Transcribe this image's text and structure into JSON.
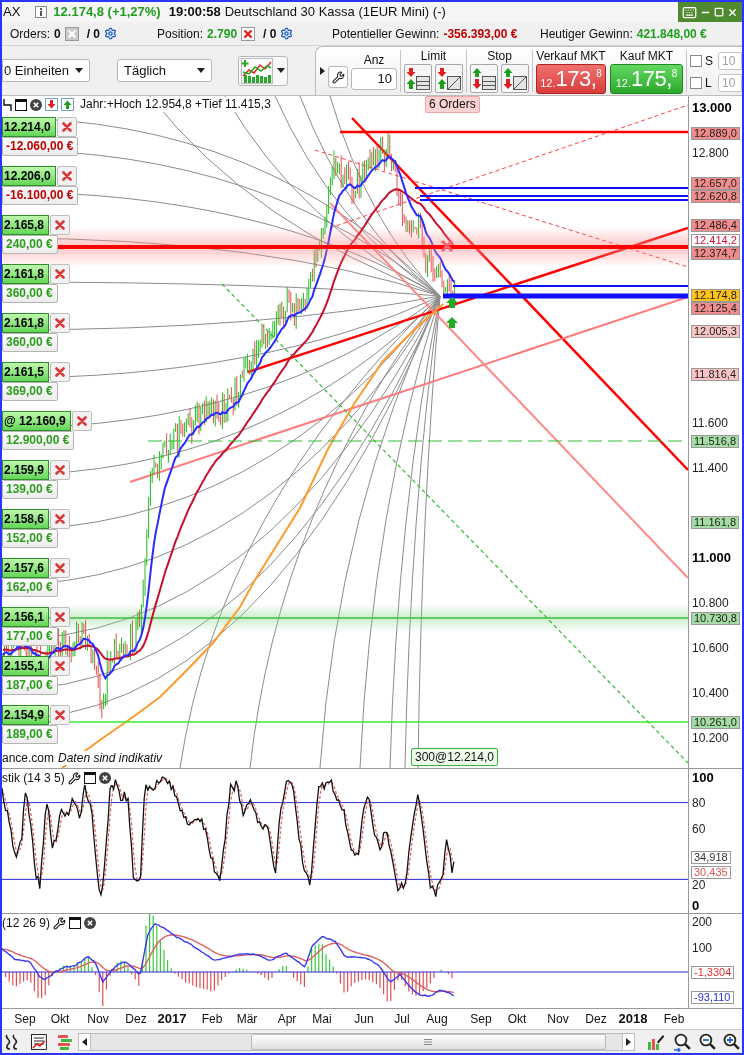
{
  "title_bar": {
    "symbol": "AX",
    "quote": "12.174,8 (+1,27%)",
    "time": "19:00:58",
    "instrument": "Deutschland 30 Kassa (1EUR Mini) (-)"
  },
  "account_bar": {
    "orders": {
      "label": "Orders:",
      "count": "0",
      "pending": "/ 0"
    },
    "position": {
      "label": "Position:",
      "value": "2.790",
      "pending": "/ 0"
    },
    "potential_profit": {
      "label": "Potentieller Gewinn:",
      "value": "-356.393,00 €"
    },
    "daily_profit": {
      "label": "Heutiger Gewinn:",
      "value": "421.848,00 €"
    }
  },
  "toolbar": {
    "units": "0 Einheiten",
    "interval": "Täglich"
  },
  "order_panel": {
    "quantity": {
      "label": "Anz",
      "value": "10"
    },
    "limit_label": "Limit",
    "stop_label": "Stop",
    "sell": {
      "label": "Verkauf MKT",
      "prefix": "12.",
      "main": "173,",
      "pip": "8"
    },
    "buy": {
      "label": "Kauf MKT",
      "prefix": "12.",
      "main": "175,",
      "pip": "8"
    },
    "sides": [
      {
        "label": "S",
        "checked": false,
        "value": "10",
        "disabled": true
      },
      {
        "label": "L",
        "checked": false,
        "value": "10",
        "disabled": true
      }
    ]
  },
  "chart": {
    "legend": "Jahr:+Hoch 12.954,8 +Tief 11.415,3",
    "orders_badge": "6 Orders",
    "orders": [
      {
        "price": "12.214,0",
        "profit": "-12.060,00 €",
        "loss": true
      },
      {
        "price": "12.206,0",
        "profit": "-16.100,00 €",
        "loss": true
      },
      {
        "price": "2.165,8",
        "profit": "240,00 €",
        "loss": false
      },
      {
        "price": "2.161,8",
        "profit": "360,00 €",
        "loss": false
      },
      {
        "price": "2.161,8",
        "profit": "360,00 €",
        "loss": false
      },
      {
        "price": "2.161,5",
        "profit": "369,00 €",
        "loss": false
      },
      {
        "price": "@ 12.160,9",
        "profit": "12.900,00 €",
        "loss": false
      },
      {
        "price": "2.159,9",
        "profit": "139,00 €",
        "loss": false
      },
      {
        "price": "2.158,6",
        "profit": "152,00 €",
        "loss": false
      },
      {
        "price": "2.157,6",
        "profit": "162,00 €",
        "loss": false
      },
      {
        "price": "2.156,1",
        "profit": "177,00 €",
        "loss": false
      },
      {
        "price": "2.155,1",
        "profit": "187,00 €",
        "loss": false
      },
      {
        "price": "2.154,9",
        "profit": "189,00 €",
        "loss": false
      }
    ],
    "source": "ance.com",
    "disclaimer": "Daten sind indikativ",
    "position_marker": "300@12.214,0",
    "axis_ticks": [
      {
        "label": "13.000",
        "major": true
      },
      {
        "label": "12.800",
        "major": false
      },
      {
        "label": "11.600",
        "major": false
      },
      {
        "label": "11.400",
        "major": false
      },
      {
        "label": "11.000",
        "major": true
      },
      {
        "label": "10.800",
        "major": false
      },
      {
        "label": "10.600",
        "major": false
      },
      {
        "label": "10.400",
        "major": false
      },
      {
        "label": "10.200",
        "major": false
      }
    ],
    "price_tags": [
      {
        "text": "12.889,0",
        "kind": "filled",
        "color": "#f28c8c"
      },
      {
        "text": "12.657,0",
        "kind": "filled",
        "color": "#f28c8c"
      },
      {
        "text": "12.620,8",
        "kind": "filled",
        "color": "#f28c8c"
      },
      {
        "text": "12.486,4",
        "kind": "filled",
        "color": "#f28c8c"
      },
      {
        "text": "12.414,2",
        "kind": "outline",
        "color": "#d0103a"
      },
      {
        "text": "12.374,7",
        "kind": "filled",
        "color": "#f28c8c"
      },
      {
        "text": "12.174,8",
        "kind": "filled",
        "color": "#ffc21a"
      },
      {
        "text": "12.125,4",
        "kind": "filled",
        "color": "#f28c8c"
      },
      {
        "text": "12.005,3",
        "kind": "filled",
        "color": "#f8c4c4"
      },
      {
        "text": "11.816,4",
        "kind": "filled",
        "color": "#f8c4c4"
      },
      {
        "text": "11.516,8",
        "kind": "filled",
        "color": "#a6dca6"
      },
      {
        "text": "11.161,8",
        "kind": "filled",
        "color": "#a6dca6"
      },
      {
        "text": "10.730,8",
        "kind": "filled",
        "color": "#a6dca6"
      },
      {
        "text": "10.261,0",
        "kind": "filled",
        "color": "#a6dca6"
      }
    ]
  },
  "stochastic": {
    "title": "stik (14 3 5)",
    "axis_ticks": [
      {
        "label": "100",
        "major": true
      },
      {
        "label": "80",
        "major": false
      },
      {
        "label": "60",
        "major": false
      },
      {
        "label": "20",
        "major": false
      },
      {
        "label": "0",
        "major": true
      }
    ],
    "value_tags": [
      {
        "text": "34,918",
        "color": "#333333"
      },
      {
        "text": "30,435",
        "color": "#e05555"
      }
    ]
  },
  "macd": {
    "title": "(12 26 9)",
    "axis_ticks": [
      {
        "label": "200",
        "major": false
      },
      {
        "label": "100",
        "major": false
      }
    ],
    "value_tags": [
      {
        "text": "-1,3304",
        "color": "#e03030"
      },
      {
        "text": "-93,110",
        "color": "#2233dd"
      }
    ]
  },
  "time_axis": [
    {
      "label": "Sep",
      "kind": "month"
    },
    {
      "label": "Okt",
      "kind": "month"
    },
    {
      "label": "Nov",
      "kind": "month"
    },
    {
      "label": "Dez",
      "kind": "month"
    },
    {
      "label": "2017",
      "kind": "year"
    },
    {
      "label": "Feb",
      "kind": "month"
    },
    {
      "label": "Mär",
      "kind": "month"
    },
    {
      "label": "Apr",
      "kind": "month"
    },
    {
      "label": "Mai",
      "kind": "month"
    },
    {
      "label": "Jun",
      "kind": "month"
    },
    {
      "label": "Jul",
      "kind": "month"
    },
    {
      "label": "Aug",
      "kind": "month"
    },
    {
      "label": "Sep",
      "kind": "month"
    },
    {
      "label": "Okt",
      "kind": "month"
    },
    {
      "label": "Nov",
      "kind": "month"
    },
    {
      "label": "Dez",
      "kind": "month"
    },
    {
      "label": "2018",
      "kind": "year"
    },
    {
      "label": "Feb",
      "kind": "month"
    }
  ]
}
